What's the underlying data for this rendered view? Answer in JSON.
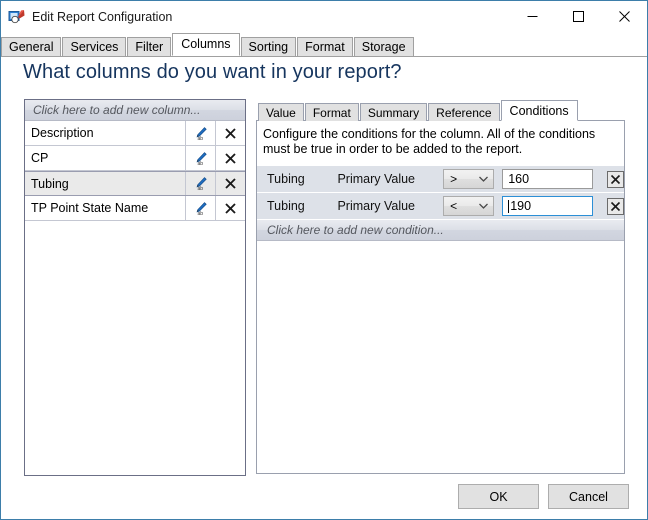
{
  "window": {
    "title": "Edit Report Configuration",
    "icon": "report-config-icon",
    "minimize_label": "—",
    "maximize_label": "□",
    "close_label": "✕",
    "border_color": "#3d7eaa"
  },
  "tabs": [
    {
      "label": "General",
      "selected": false
    },
    {
      "label": "Services",
      "selected": false
    },
    {
      "label": "Filter",
      "selected": false
    },
    {
      "label": "Columns",
      "selected": true
    },
    {
      "label": "Sorting",
      "selected": false
    },
    {
      "label": "Format",
      "selected": false
    },
    {
      "label": "Storage",
      "selected": false
    }
  ],
  "heading": "What columns do you want in your report?",
  "columns_panel": {
    "add_new_label": "Click here to add new column...",
    "rows": [
      {
        "name": "Description",
        "selected": false,
        "edit_icon": "pencil-ab-icon",
        "delete_icon": "close-x-icon"
      },
      {
        "name": "CP",
        "selected": false,
        "edit_icon": "pencil-ab-icon",
        "delete_icon": "close-x-icon"
      },
      {
        "name": "Tubing",
        "selected": true,
        "edit_icon": "pencil-ab-icon",
        "delete_icon": "close-x-icon"
      },
      {
        "name": "TP Point State Name",
        "selected": false,
        "edit_icon": "pencil-ab-icon",
        "delete_icon": "close-x-icon"
      }
    ]
  },
  "detail_panel": {
    "tabs": [
      {
        "label": "Value",
        "selected": false
      },
      {
        "label": "Format",
        "selected": false
      },
      {
        "label": "Summary",
        "selected": false
      },
      {
        "label": "Reference",
        "selected": false
      },
      {
        "label": "Conditions",
        "selected": true
      }
    ],
    "description": "Configure the conditions for the column.  All of the conditions must be true in order to be added to the report.",
    "conditions": [
      {
        "column": "Tubing",
        "property": "Primary Value",
        "operator": ">",
        "value": "160",
        "focused": false,
        "delete_icon": "close-x-icon",
        "dropdown_icon": "chevron-down-icon"
      },
      {
        "column": "Tubing",
        "property": "Primary Value",
        "operator": "<",
        "value": "190",
        "focused": true,
        "delete_icon": "close-x-icon",
        "dropdown_icon": "chevron-down-icon"
      }
    ],
    "add_new_label": "Click here to add new condition...",
    "operator_options": [
      ">",
      "<",
      "=",
      ">=",
      "<=",
      "<>"
    ]
  },
  "buttons": {
    "ok": "OK",
    "cancel": "Cancel"
  }
}
